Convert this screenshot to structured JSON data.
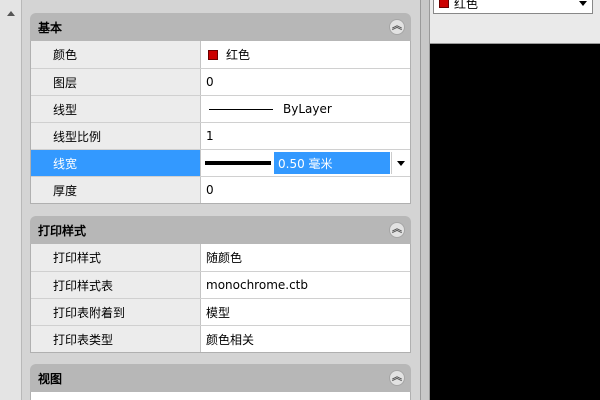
{
  "sections": [
    {
      "title": "基本",
      "rows": [
        {
          "label": "颜色",
          "value": "红色"
        },
        {
          "label": "图层",
          "value": "0"
        },
        {
          "label": "线型",
          "value": "ByLayer"
        },
        {
          "label": "线型比例",
          "value": "1"
        },
        {
          "label": "线宽",
          "value": "0.50 毫米"
        },
        {
          "label": "厚度",
          "value": "0"
        }
      ]
    },
    {
      "title": "打印样式",
      "rows": [
        {
          "label": "打印样式",
          "value": "随颜色"
        },
        {
          "label": "打印样式表",
          "value": "monochrome.ctb"
        },
        {
          "label": "打印表附着到",
          "value": "模型"
        },
        {
          "label": "打印表类型",
          "value": "颜色相关"
        }
      ]
    },
    {
      "title": "视图",
      "rows": []
    }
  ],
  "toolbar": {
    "color_combo_value": "红色"
  },
  "colors": {
    "red_swatch": "#cc0000",
    "selection": "#3399ff",
    "canvas": "#000000"
  }
}
